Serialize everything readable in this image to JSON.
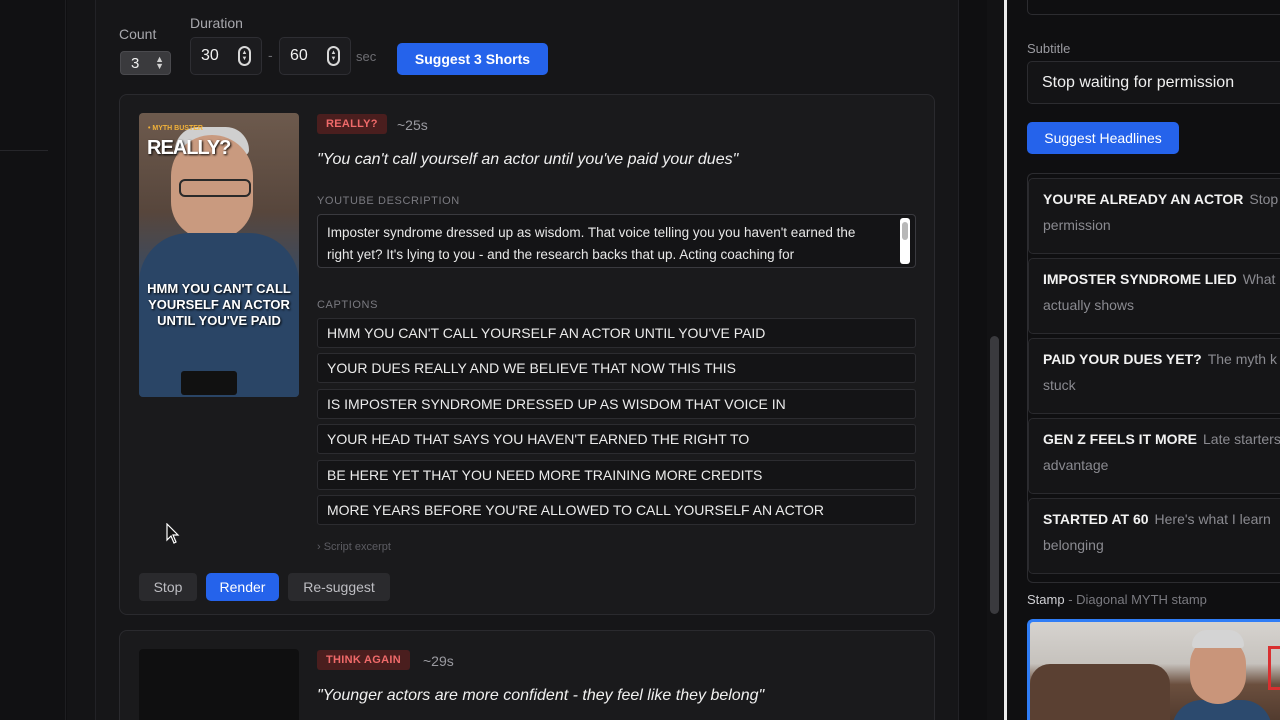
{
  "controls": {
    "count_label": "Count",
    "count_value": "3",
    "duration_label": "Duration",
    "duration_min": "30",
    "duration_sep": "-",
    "duration_max": "60",
    "duration_unit": "sec",
    "suggest_button": "Suggest 3 Shorts"
  },
  "shorts": [
    {
      "badge": "REALLY?",
      "duration": "~25s",
      "hook": "\"You can't call yourself an actor until you've paid your dues\"",
      "thumbnail": {
        "tag": "• MYTH BUSTER",
        "title": "REALLY?",
        "caption": "HMM YOU CAN'T CALL YOURSELF AN ACTOR UNTIL YOU'VE PAID"
      },
      "description_label": "YOUTUBE DESCRIPTION",
      "description": "Imposter syndrome dressed up as wisdom. That voice telling you you haven't earned the right yet? It's lying to you - and the research backs that up. Acting coaching for",
      "captions_label": "CAPTIONS",
      "captions": [
        "HMM YOU CAN'T CALL YOURSELF AN ACTOR UNTIL YOU'VE PAID",
        "YOUR DUES REALLY AND WE BELIEVE THAT NOW THIS THIS",
        "IS IMPOSTER SYNDROME DRESSED UP AS WISDOM THAT VOICE IN",
        "YOUR HEAD THAT SAYS YOU HAVEN'T EARNED THE RIGHT TO",
        "BE HERE YET THAT YOU NEED MORE TRAINING MORE CREDITS",
        "MORE YEARS BEFORE YOU'RE ALLOWED TO CALL YOURSELF AN ACTOR"
      ],
      "excerpt": "› Script excerpt",
      "stop_button": "Stop",
      "render_button": "Render",
      "resuggest_button": "Re-suggest"
    },
    {
      "badge": "THINK AGAIN",
      "duration": "~29s",
      "hook": "\"Younger actors are more confident - they feel like they belong\""
    }
  ],
  "right_panel": {
    "subtitle_label": "Subtitle",
    "subtitle_value": "Stop waiting for permission",
    "suggest_headlines_button": "Suggest Headlines",
    "headlines": [
      {
        "title": "YOU'RE ALREADY AN ACTOR",
        "text": "Stop",
        "line2": "permission"
      },
      {
        "title": "IMPOSTER SYNDROME LIED",
        "text": "What",
        "line2": "actually shows"
      },
      {
        "title": "PAID YOUR DUES YET?",
        "text": "The myth k",
        "line2": "stuck"
      },
      {
        "title": "GEN Z FEELS IT MORE",
        "text": "Late starters",
        "line2": "advantage"
      },
      {
        "title": "STARTED AT 60",
        "text": "Here's what I learn",
        "line2": "belonging"
      }
    ],
    "stamp_label": "Stamp",
    "stamp_desc": "- Diagonal MYTH stamp"
  },
  "colors": {
    "accent_blue": "#2563eb",
    "badge_red_bg": "#4a1e1e",
    "badge_red_text": "#f06a6a",
    "panel_bg": "#161618"
  }
}
